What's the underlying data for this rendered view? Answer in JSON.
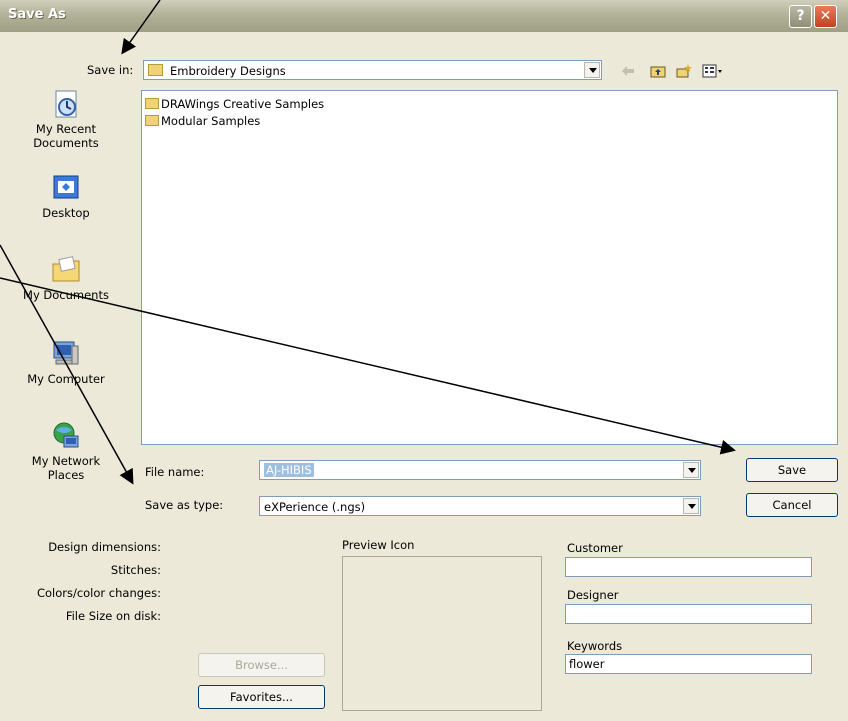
{
  "dialog": {
    "title": "Save As"
  },
  "titlebar": {
    "help_label": "?",
    "close_label": "✕"
  },
  "save_in": {
    "label": "Save in:",
    "value": "Embroidery Designs"
  },
  "toolbar": {
    "icons": [
      "back-icon",
      "up-folder-icon",
      "new-folder-icon",
      "view-menu-icon"
    ]
  },
  "places": [
    {
      "label": "My Recent\nDocuments",
      "icon": "recent-documents-icon"
    },
    {
      "label": "Desktop",
      "icon": "desktop-icon"
    },
    {
      "label": "My Documents",
      "icon": "my-documents-icon"
    },
    {
      "label": "My Computer",
      "icon": "my-computer-icon"
    },
    {
      "label": "My Network\nPlaces",
      "icon": "network-places-icon"
    }
  ],
  "files": [
    {
      "name": "DRAWings Creative Samples"
    },
    {
      "name": "Modular Samples"
    }
  ],
  "file_name": {
    "label": "File name:",
    "value": "AJ-HIBIS"
  },
  "save_as_type": {
    "label": "Save as type:",
    "value": "eXPerience (.ngs)"
  },
  "buttons": {
    "save": "Save",
    "cancel": "Cancel",
    "browse": "Browse...",
    "favorites": "Favorites..."
  },
  "info": {
    "design_dimensions": "Design dimensions:",
    "stitches": "Stitches:",
    "colors": "Colors/color changes:",
    "file_size": "File Size on disk:"
  },
  "preview": {
    "label": "Preview Icon"
  },
  "metadata": {
    "customer_label": "Customer",
    "customer_value": "",
    "designer_label": "Designer",
    "designer_value": "",
    "keywords_label": "Keywords",
    "keywords_value": "flower"
  }
}
